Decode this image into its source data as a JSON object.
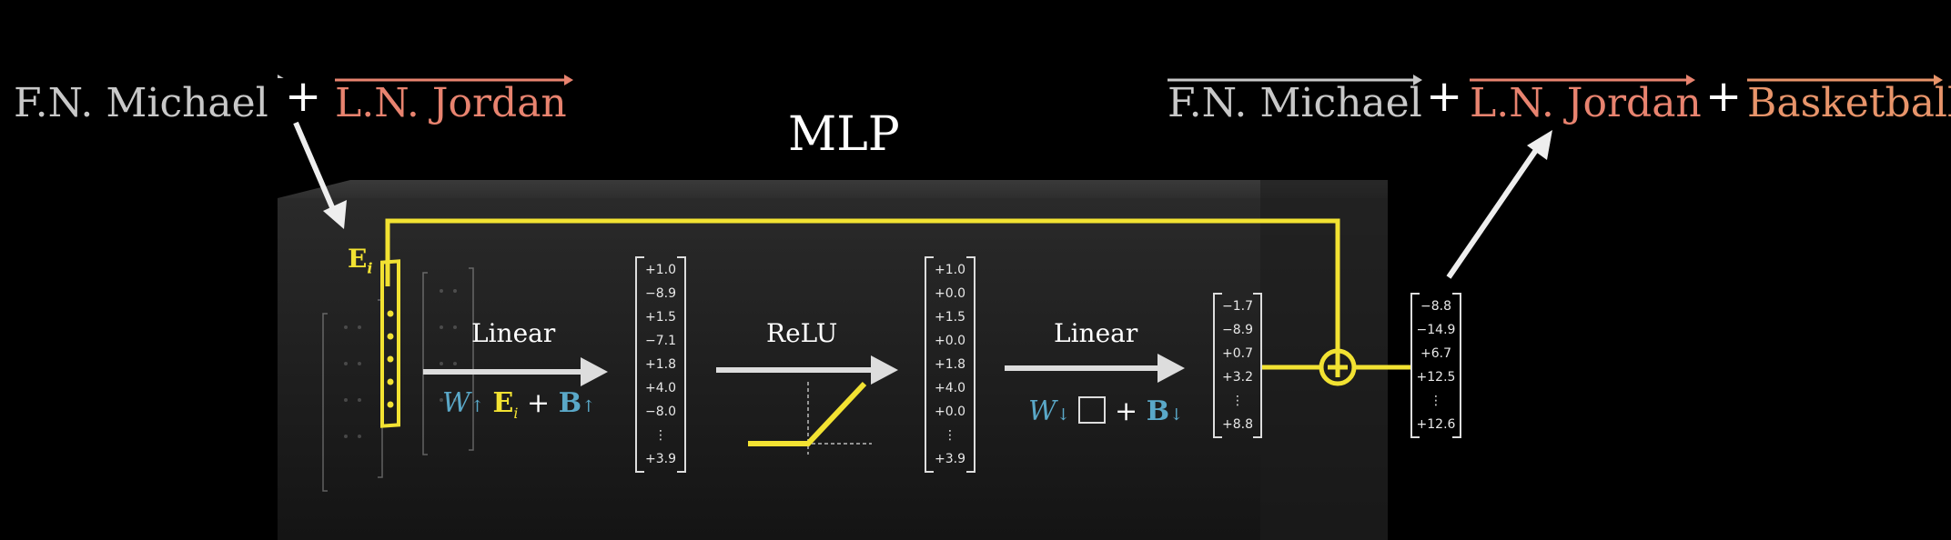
{
  "input_terms": {
    "first": "F.N. Michael",
    "plus": "+",
    "second": "L.N. Jordan"
  },
  "output_terms": {
    "first": "F.N. Michael",
    "plus1": "+",
    "second": "L.N. Jordan",
    "plus2": "+",
    "third": "Basketball"
  },
  "block_title": "MLP",
  "embedding_label": "E",
  "embedding_sub": "i",
  "stages": {
    "linear_up": {
      "label": "Linear",
      "formula_w": "W",
      "formula_e": "E",
      "formula_i": "i",
      "formula_b": "B"
    },
    "relu": {
      "label": "ReLU"
    },
    "linear_down": {
      "label": "Linear",
      "formula_w": "W",
      "formula_b": "B"
    }
  },
  "vectors": {
    "hidden": [
      "+1.0",
      "−8.9",
      "+1.5",
      "−7.1",
      "+1.8",
      "+4.0",
      "−8.0",
      "⋮",
      "+3.9"
    ],
    "activated": [
      "+1.0",
      "+0.0",
      "+1.5",
      "+0.0",
      "+1.8",
      "+4.0",
      "+0.0",
      "⋮",
      "+3.9"
    ],
    "down": [
      "−1.7",
      "−8.9",
      "+0.7",
      "+3.2",
      "⋮",
      "+8.8"
    ],
    "result": [
      "−8.8",
      "−14.9",
      "+6.7",
      "+12.5",
      "⋮",
      "+12.6"
    ]
  },
  "colors": {
    "yellow": "#f2e232",
    "salmon": "#e8836f",
    "orange": "#e8946a",
    "gray_text": "#c8c8c8",
    "blue": "#5aa8c8"
  },
  "icons": [
    "down-arrow-icon",
    "right-arrow-icon",
    "plus-circle-icon",
    "relu-graph-icon",
    "up-arrow-icon"
  ]
}
